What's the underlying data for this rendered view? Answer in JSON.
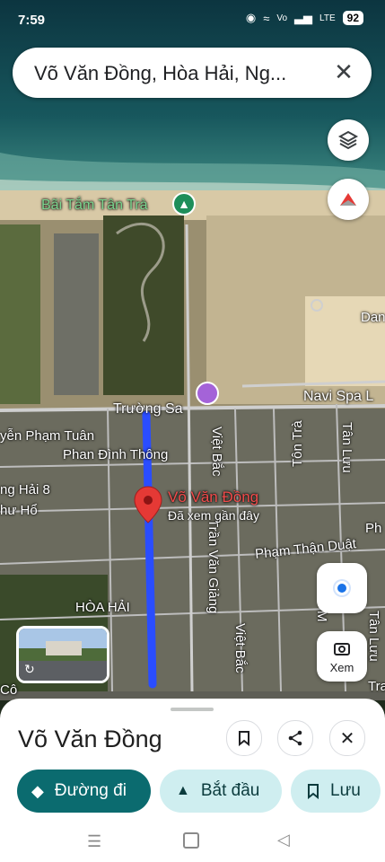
{
  "status_bar": {
    "time": "7:59",
    "volte": "Vo",
    "lte": "LTE",
    "battery": "92"
  },
  "search": {
    "query": "Võ Văn Đồng, Hòa Hải, Ng..."
  },
  "map": {
    "beach_label": "Bãi Tắm Tân Trà",
    "roads": [
      "Trường Sa",
      "Navi Spa L",
      "yễn Phạm Tuân",
      "Phan Đình Thông",
      "ng Hải 8",
      "hư Hổ",
      "Việt Bắc",
      "Tôn Trà",
      "Tân Lưu",
      "Trần Văn Giảng",
      "Phạm Thận Duật",
      "Ph",
      "Việt Bắc",
      "HÒA HẢI",
      "Dan",
      "Tân Lưu",
      "Tra",
      "Cô",
      "M"
    ],
    "pin_title": "Võ Văn Đồng",
    "pin_subtitle": "Đã xem gần đây",
    "route_color": "#2a4dff",
    "pin_color": "#e53935"
  },
  "controls": {
    "camera_label": "Xem"
  },
  "sheet": {
    "title": "Võ Văn Đồng",
    "directions_label": "Đường đi",
    "start_label": "Bắt đầu",
    "save_label": "Lưu"
  }
}
